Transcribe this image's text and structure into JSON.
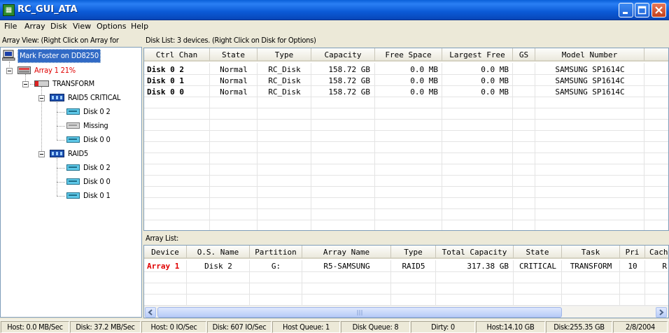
{
  "window": {
    "title": "RC_GUI_ATA"
  },
  "menu": [
    "File",
    "Array",
    "Disk",
    "View",
    "Options",
    "Help"
  ],
  "left_pane": {
    "header": "Array View:  (Right Click on Array for",
    "tree": [
      {
        "label": "Mark Foster on DD8250",
        "icon": "computer-icon",
        "selected": true
      },
      {
        "label": "Array 1  21%",
        "icon": "array-icon",
        "red": true
      },
      {
        "label": "TRANSFORM",
        "icon": "transform-icon"
      },
      {
        "label": "RAID5 CRITICAL",
        "icon": "raid-icon"
      },
      {
        "label": "Disk  0 2",
        "icon": "disk-icon"
      },
      {
        "label": "Missing",
        "icon": "missing-disk-icon"
      },
      {
        "label": "Disk  0 0",
        "icon": "disk-icon"
      },
      {
        "label": "RAID5",
        "icon": "raid-icon"
      },
      {
        "label": "Disk  0 2",
        "icon": "disk-icon"
      },
      {
        "label": "Disk  0 0",
        "icon": "disk-icon"
      },
      {
        "label": "Disk  0 1",
        "icon": "disk-icon"
      }
    ]
  },
  "disk_list": {
    "header": "Disk List: 3 devices.  (Right Click on Disk for Options)",
    "columns": [
      "Ctrl Chan",
      "State",
      "Type",
      "Capacity",
      "Free Space",
      "Largest Free",
      "GS",
      "Model Number"
    ],
    "rows": [
      [
        "Disk  0 2",
        "Normal",
        "RC_Disk",
        "158.72 GB",
        "0.0 MB",
        "0.0 MB",
        "",
        "SAMSUNG SP1614C"
      ],
      [
        "Disk  0 1",
        "Normal",
        "RC_Disk",
        "158.72 GB",
        "0.0 MB",
        "0.0 MB",
        "",
        "SAMSUNG SP1614C"
      ],
      [
        "Disk  0 0",
        "Normal",
        "RC_Disk",
        "158.72 GB",
        "0.0 MB",
        "0.0 MB",
        "",
        "SAMSUNG SP1614C"
      ]
    ]
  },
  "array_list": {
    "header": "Array List:",
    "columns": [
      "Device",
      "O.S. Name",
      "Partition",
      "Array Name",
      "Type",
      "Total Capacity",
      "State",
      "Task",
      "Pri",
      "Cach"
    ],
    "rows": [
      [
        "Array 1",
        "Disk 2",
        "G:",
        "R5-SAMSUNG",
        "RAID5",
        "317.38 GB",
        "CRITICAL",
        "TRANSFORM",
        "10",
        "R"
      ]
    ]
  },
  "status_bar": [
    "Host: 0.0 MB/Sec",
    "Disk: 37.2 MB/Sec",
    "Host: 0 IO/Sec",
    "Disk: 607 IO/Sec",
    "Host Queue: 1",
    "Disk Queue: 8",
    "Dirty: 0",
    "Host:14.10 GB",
    "Disk:255.35 GB",
    "2/8/2004"
  ],
  "colors": {
    "title_bar": "#0a5fd8",
    "selection": "#316ac5",
    "alert_text": "#e00000"
  }
}
